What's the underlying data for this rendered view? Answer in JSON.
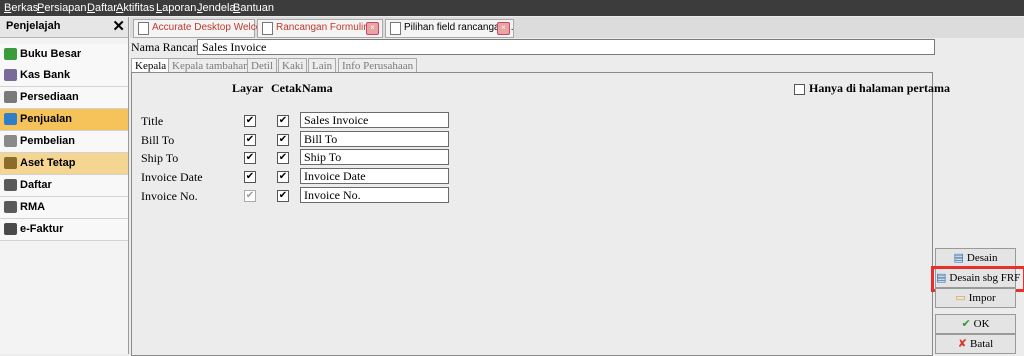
{
  "menu": [
    "Berkas",
    "Persiapan",
    "Daftar",
    "Aktifitas",
    "Laporan",
    "Jendela",
    "Bantuan"
  ],
  "sidebar": {
    "title": "Penjelajah",
    "close": "✕",
    "items": [
      {
        "label": "Buku Besar",
        "icon": "ledger-icon",
        "color": "#3a9b3a"
      },
      {
        "label": "Kas Bank",
        "icon": "bank-icon",
        "color": "#7a6a9a"
      },
      {
        "label": "Persediaan",
        "icon": "inventory-icon",
        "color": "#7a7a7a"
      },
      {
        "label": "Penjualan",
        "icon": "sales-icon",
        "color": "#2f7fc8"
      },
      {
        "label": "Pembelian",
        "icon": "cart-icon",
        "color": "#8a8a8a"
      },
      {
        "label": "Aset Tetap",
        "icon": "house-icon",
        "color": "#8a6d2a"
      },
      {
        "label": "Daftar",
        "icon": "list-icon",
        "color": "#5a5a5a"
      },
      {
        "label": "RMA",
        "icon": "rma-icon",
        "color": "#5a5a5a"
      },
      {
        "label": "e-Faktur",
        "icon": "efaktur-icon",
        "color": "#4a4a4a"
      }
    ]
  },
  "tabs": [
    {
      "label": "Accurate Desktop Welcome"
    },
    {
      "label": "Rancangan Formulir"
    },
    {
      "label": "Pilihan field rancangan..."
    }
  ],
  "form": {
    "nama_label": "Nama Rancangan:",
    "nama_value": "Sales Invoice",
    "subtabs": [
      "Kepala",
      "Kepala tambahan",
      "Detil",
      "Kaki",
      "Lain",
      "Info Perusahaan"
    ],
    "col_layar": "Layar",
    "col_cetak": "Cetak",
    "col_nama": "Nama",
    "first_page": "Hanya di halaman pertama",
    "rows": [
      {
        "label": "Title",
        "layar": true,
        "cetak": true,
        "nama": "Sales Invoice"
      },
      {
        "label": "Bill To",
        "layar": true,
        "cetak": true,
        "nama": "Bill To"
      },
      {
        "label": "Ship To",
        "layar": true,
        "cetak": true,
        "nama": "Ship To"
      },
      {
        "label": "Invoice Date",
        "layar": true,
        "cetak": true,
        "nama": "Invoice Date"
      },
      {
        "label": "Invoice No.",
        "layar": true,
        "cetak": true,
        "nama": "Invoice No."
      }
    ]
  },
  "buttons": {
    "desain": "Desain",
    "desain_frf": "Desain sbg FRF",
    "impor": "Impor",
    "ok": "OK",
    "batal": "Batal"
  },
  "glyphs": {
    "check": "✔",
    "ok": "✔",
    "batal": "✘",
    "close": "×"
  },
  "colors": {
    "highlight": "#e8302a",
    "active_item": "#f6c35a",
    "tab_text": "#c0392b"
  }
}
